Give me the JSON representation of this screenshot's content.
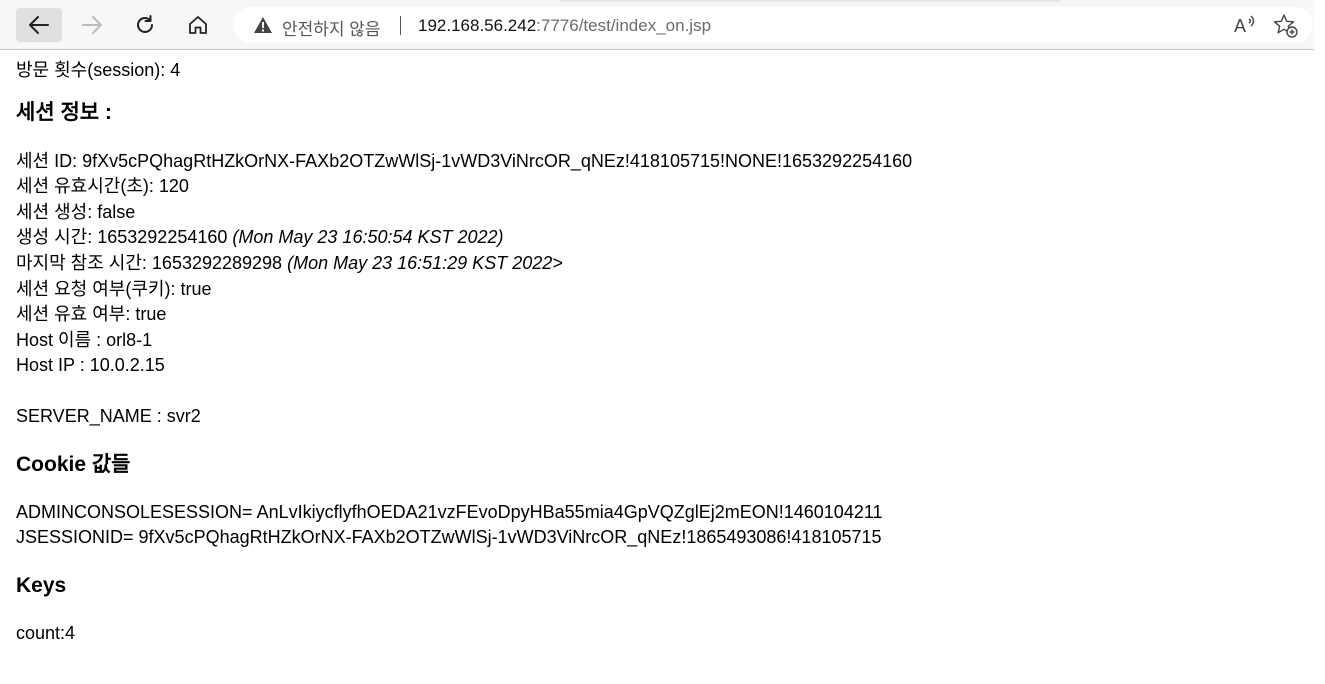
{
  "browser": {
    "security_label": "안전하지 않음",
    "url_host": "192.168.56.242",
    "url_rest": ":7776/test/index_on.jsp",
    "icons": {
      "back": "arrow-left-icon",
      "forward": "arrow-right-icon",
      "reload": "reload-icon",
      "home": "home-icon",
      "warning": "warning-triangle-icon",
      "read_aloud": "read-aloud-icon",
      "favorite": "add-favorite-icon"
    }
  },
  "page": {
    "visit_count": "방문 횟수(session): 4",
    "session_heading": "세션 정보 :",
    "session_lines": {
      "id": "세션 ID: 9fXv5cPQhagRtHZkOrNX-FAXb2OTZwWlSj-1vWD3ViNrcOR_qNEz!418105715!NONE!1653292254160",
      "timeout": "세션 유효시간(초): 120",
      "is_new": "세션 생성: false",
      "created_prefix": "생성 시간: 1653292254160 ",
      "created_date": "(Mon May 23 16:50:54 KST 2022)",
      "last_prefix": "마지막 참조 시간: 1653292289298 ",
      "last_date": "(Mon May 23 16:51:29 KST 2022>",
      "from_cookie": "세션 요청 여부(쿠키): true",
      "valid": "세션 유효 여부: true",
      "host_name": "Host 이름 : orl8-1",
      "host_ip": "Host IP : 10.0.2.15",
      "server_name": "SERVER_NAME : svr2"
    },
    "cookie_heading": "Cookie 값들",
    "cookies": {
      "admin": "ADMINCONSOLESESSION= AnLvIkiycflyfhOEDA21vzFEvoDpyHBa55mia4GpVQZglEj2mEON!1460104211",
      "jsession": "JSESSIONID= 9fXv5cPQhagRtHZkOrNX-FAXb2OTZwWlSj-1vWD3ViNrcOR_qNEz!1865493086!418105715"
    },
    "keys_heading": "Keys",
    "keys_line": "count:4"
  }
}
